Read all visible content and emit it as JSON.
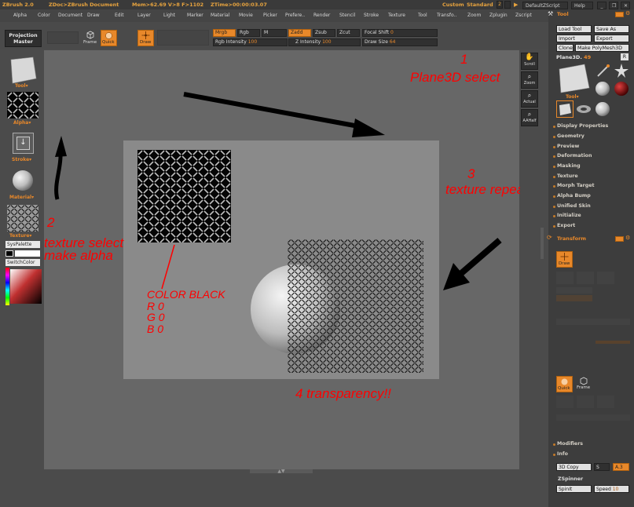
{
  "titlebar": {
    "app": "ZBrush 2.0",
    "doc": "ZDoc>ZBrush Document",
    "stats": "Mem>62.69 V>8 F>1102",
    "ztime": "ZTime>00:00:03.07",
    "custom": "Custom",
    "standard": "Standard",
    "script": "DefaultZScript",
    "help": "Help"
  },
  "menu": [
    "Alpha",
    "Color",
    "Document",
    "Draw",
    "Edit",
    "Layer",
    "Light",
    "Marker",
    "Material",
    "Movie",
    "Picker",
    "Prefere..",
    "Render",
    "Stencil",
    "Stroke",
    "Texture",
    "Tool",
    "Transfo..",
    "Zoom",
    "Zplugin",
    "Zscript"
  ],
  "toolbar": {
    "projection_master": "Projection Master",
    "frame": "Frame",
    "quick": "Quick",
    "draw": "Draw",
    "mrgb": "Mrgb",
    "rgb": "Rgb",
    "m": "M",
    "zadd": "Zadd",
    "zsub": "Zsub",
    "zcut": "Zcut",
    "focal_shift": "Focal Shift",
    "focal_shift_value": "0",
    "rgb_intensity": "Rgb Intensity",
    "rgb_intensity_value": "100",
    "z_intensity": "Z Intensity",
    "z_intensity_value": "100",
    "draw_size": "Draw Size",
    "draw_size_value": "64"
  },
  "left_tray": {
    "tool": "Tool",
    "alpha": "Alpha",
    "stroke": "Stroke",
    "material": "Material",
    "texture": "Texture",
    "syspalette": "SysPalette",
    "switchcolor": "SwitchColor"
  },
  "right_tray": [
    "Scroll",
    "Zoom",
    "Actual",
    "AAHalf"
  ],
  "palette": {
    "title": "Tool",
    "load_tool": "Load Tool",
    "save_as": "Save As",
    "import": "Import",
    "export": "Export",
    "clone": "Clone",
    "make_polymesh": "Make PolyMesh3D",
    "current_tool": "Plane3D",
    "current_tool_count": "49",
    "r": "R",
    "items": [
      "Display Properties",
      "Geometry",
      "Preview",
      "Deformation",
      "Masking",
      "Texture",
      "Morph Target",
      "Alpha Bump",
      "Unified Skin",
      "Initialize",
      "Export"
    ],
    "transform": "Transform",
    "draw": "Draw",
    "quick": "Quick",
    "frame": "Frame",
    "modifiers": "Modifiers",
    "info": "Info",
    "copy_3d": "3D Copy",
    "copy_s": "S",
    "copy_a": "A.3",
    "zspinner": "ZSpinner",
    "spinit": "SpinIt",
    "speed": "Speed",
    "speed_value": "10"
  },
  "annotations": {
    "a1_num": "1",
    "a1_text": "Plane3D select",
    "a2_num": "2",
    "a2_line1": "texture select",
    "a2_line2": "make alpha",
    "a3_num": "3",
    "a3_text": "texture repeat",
    "a4_text": "4  transparency!!",
    "color_title": "COLOR BLACK",
    "color_r": "R 0",
    "color_g": "G 0",
    "color_b": "B 0"
  },
  "colors": {
    "accent": "#e8882a",
    "annotation": "#ff0000"
  }
}
